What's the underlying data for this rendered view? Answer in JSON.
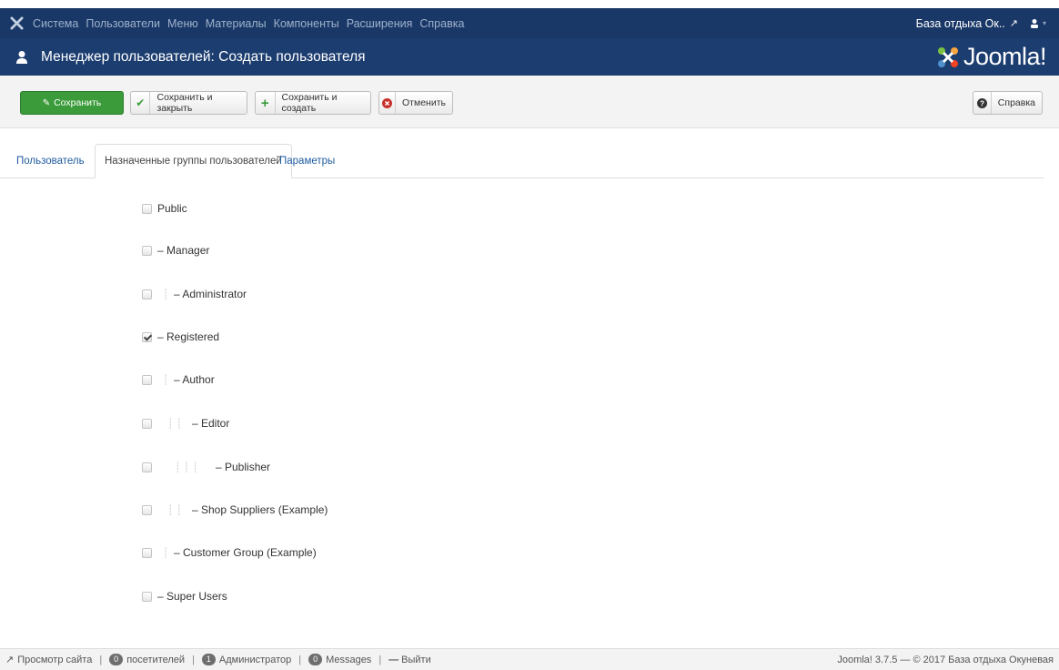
{
  "navbar": {
    "menu": [
      "Система",
      "Пользователи",
      "Меню",
      "Материалы",
      "Компоненты",
      "Расширения",
      "Справка"
    ],
    "site_name": "База отдыха Ок.."
  },
  "header": {
    "title": "Менеджер пользователей: Создать пользователя",
    "brand": "Joomla!"
  },
  "toolbar": {
    "save": "Сохранить",
    "save_close": "Сохранить и закрыть",
    "save_new": "Сохранить и создать",
    "cancel": "Отменить",
    "help": "Справка"
  },
  "tabs": [
    {
      "label": "Пользователь"
    },
    {
      "label": "Назначенные группы пользователей"
    },
    {
      "label": "Параметры"
    }
  ],
  "groups": [
    {
      "label": "Public",
      "prefix": "",
      "checked": false
    },
    {
      "label": "– Manager",
      "prefix": "",
      "checked": false
    },
    {
      "label": "– Administrator",
      "prefix": "┊",
      "checked": false
    },
    {
      "label": "– Registered",
      "prefix": "",
      "checked": true
    },
    {
      "label": "– Author",
      "prefix": "┊",
      "checked": false
    },
    {
      "label": "– Editor",
      "prefix": "┊ ┊",
      "checked": false
    },
    {
      "label": "– Publisher",
      "prefix": "┊ ┊ ┊",
      "checked": false
    },
    {
      "label": "– Shop Suppliers (Example)",
      "prefix": "┊ ┊",
      "checked": false
    },
    {
      "label": "– Customer Group (Example)",
      "prefix": "┊",
      "checked": false
    },
    {
      "label": "– Super Users",
      "prefix": "",
      "checked": false
    }
  ],
  "footer": {
    "view_site": "Просмотр сайта",
    "visitors_count": "0",
    "visitors_label": "посетителей",
    "admins_count": "1",
    "admins_label": "Администратор",
    "messages_count": "0",
    "messages_label": "Messages",
    "logout": "Выйти",
    "copyright": "Joomla! 3.7.5 — © 2017 База отдыха Окуневая"
  },
  "colors": {
    "navbar": "#1a3867",
    "header": "#1c3d70",
    "save_button": "#3b9b3a",
    "link": "#1f5b9e"
  }
}
